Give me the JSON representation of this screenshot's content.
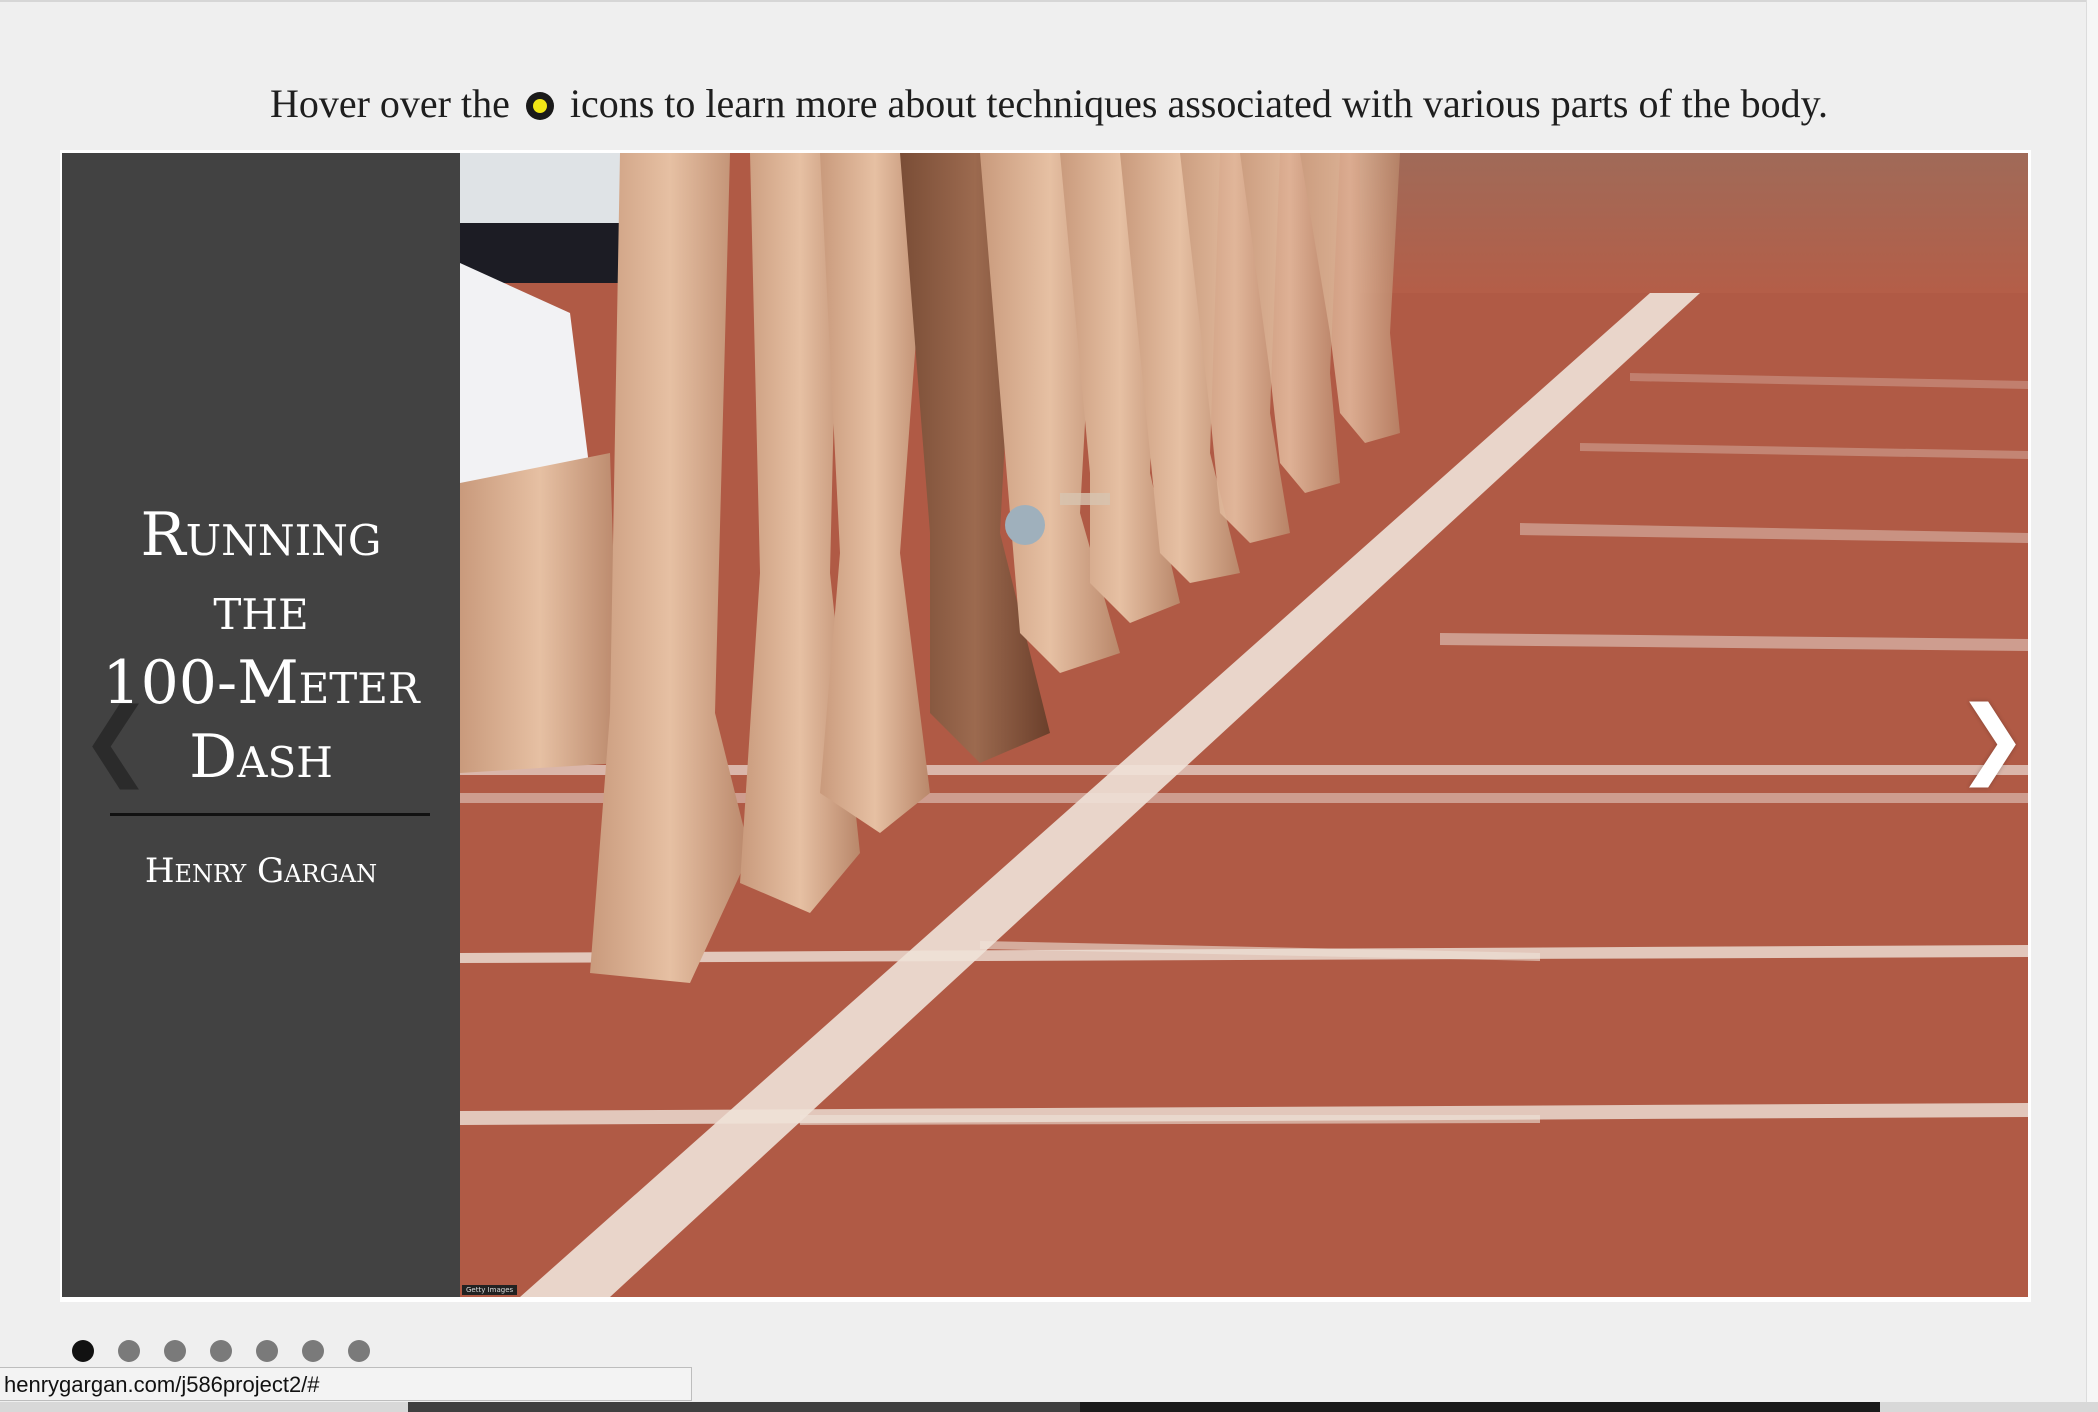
{
  "instructions": {
    "before_icon": "Hover over the",
    "after_icon": "icons to learn more about techniques associated with various parts of the body.",
    "icon": "hotspot-circle-icon"
  },
  "slide": {
    "title_lines": [
      "Running",
      "the",
      "100-Meter",
      "Dash"
    ],
    "author": "Henry Gargan",
    "photo_caption": "Getty Images",
    "prev_label": "❮",
    "next_label": "❯"
  },
  "pagination": {
    "total": 7,
    "active_index": 0
  },
  "status_bar": {
    "url": "henrygargan.com/j586project2/#"
  },
  "colors": {
    "panel": "#424242",
    "track": "#b25a45",
    "hotspot_yellow": "#f1e616",
    "dot_active": "#111111",
    "dot_inactive": "#7a7a7a"
  }
}
